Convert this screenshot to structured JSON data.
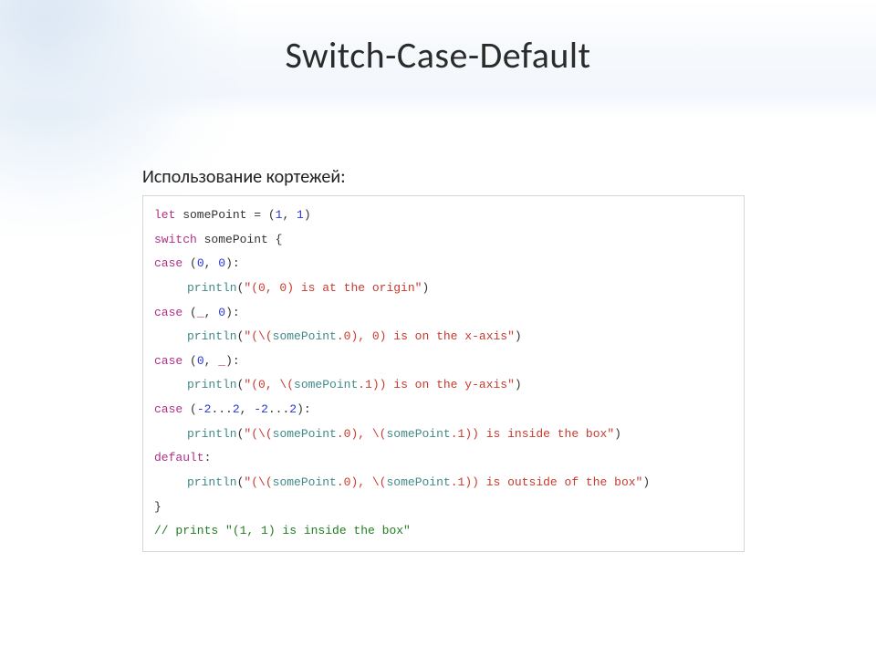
{
  "title": "Switch-Case-Default",
  "subtitle": "Использование кортежей:",
  "code": {
    "kw_let": "let",
    "decl_name": " somePoint = (",
    "one_a": "1",
    "comma_sp": ", ",
    "one_b": "1",
    "close_paren": ")",
    "kw_switch": "switch",
    "switch_expr": " somePoint {",
    "kw_case": "case",
    "case0_close": "):",
    "zero": "0",
    "underscore": "_",
    "neg2a": "-2",
    "dots": "...",
    "two_a": "2",
    "neg2b": "-2",
    "two_b": "2",
    "kw_println": "println",
    "open_call": "(",
    "close_call": ")",
    "str_origin": "\"(0, 0) is at the origin\"",
    "str_xaxis_a": "\"(\\(",
    "str_xaxis_id": "somePoint",
    "str_xaxis_b": ".0",
    "str_xaxis_c": "), 0) is on the x-axis\"",
    "str_yaxis_a": "\"(0, \\(",
    "str_yaxis_id": "somePoint",
    "str_yaxis_b": ".1",
    "str_yaxis_c": ")) is on the y-axis\"",
    "str_inside_a": "\"(\\(",
    "str_inside_id0": "somePoint",
    "str_inside_b": ".0",
    "str_inside_c": "), \\(",
    "str_inside_id1": "somePoint",
    "str_inside_d": ".1",
    "str_inside_e": ")) is inside the box\"",
    "kw_default": "default",
    "default_colon": ":",
    "str_outside_a": "\"(\\(",
    "str_outside_id0": "somePoint",
    "str_outside_b": ".0",
    "str_outside_c": "), \\(",
    "str_outside_id1": "somePoint",
    "str_outside_d": ".1",
    "str_outside_e": ")) is outside of the box\"",
    "close_brace": "}",
    "comment": "// prints \"(1, 1) is inside the box\"",
    "open_paren_plain": " (",
    "comma_sp2": ", "
  }
}
